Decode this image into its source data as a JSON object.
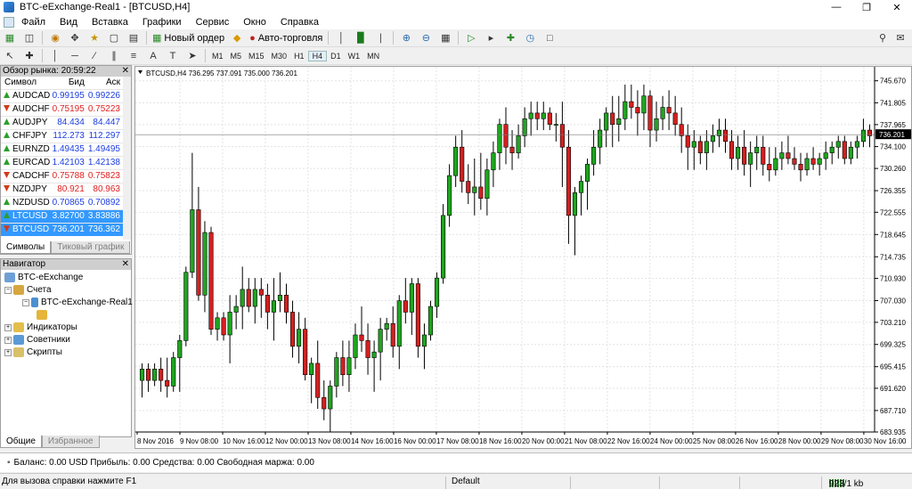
{
  "window": {
    "title": "BTC-eExchange-Real1 - [BTCUSD,H4]"
  },
  "menu": [
    "Файл",
    "Вид",
    "Вставка",
    "Графики",
    "Сервис",
    "Окно",
    "Справка"
  ],
  "toolbar": {
    "new_order": "Новый ордер",
    "autotrading": "Авто-торговля"
  },
  "timeframes": [
    "M1",
    "M5",
    "M15",
    "M30",
    "H1",
    "H4",
    "D1",
    "W1",
    "MN"
  ],
  "active_timeframe": "H4",
  "market_watch": {
    "header": "Обзор рынка: 20:59:22",
    "columns": [
      "Символ",
      "Бид",
      "Аск"
    ],
    "rows": [
      {
        "symbol": "AUDCAD",
        "bid": "0.99195",
        "ask": "0.99226",
        "dir": "up"
      },
      {
        "symbol": "AUDCHF",
        "bid": "0.75195",
        "ask": "0.75223",
        "dir": "down"
      },
      {
        "symbol": "AUDJPY",
        "bid": "84.434",
        "ask": "84.447",
        "dir": "up"
      },
      {
        "symbol": "CHFJPY",
        "bid": "112.273",
        "ask": "112.297",
        "dir": "up"
      },
      {
        "symbol": "EURNZD",
        "bid": "1.49435",
        "ask": "1.49495",
        "dir": "up"
      },
      {
        "symbol": "EURCAD",
        "bid": "1.42103",
        "ask": "1.42138",
        "dir": "up"
      },
      {
        "symbol": "CADCHF",
        "bid": "0.75788",
        "ask": "0.75823",
        "dir": "down"
      },
      {
        "symbol": "NZDJPY",
        "bid": "80.921",
        "ask": "80.963",
        "dir": "down"
      },
      {
        "symbol": "NZDUSD",
        "bid": "0.70865",
        "ask": "0.70892",
        "dir": "up"
      },
      {
        "symbol": "LTCUSD",
        "bid": "3.82700",
        "ask": "3.83886",
        "dir": "up",
        "selected": true
      },
      {
        "symbol": "BTCUSD",
        "bid": "736.201",
        "ask": "736.362",
        "dir": "down",
        "selected": true
      }
    ],
    "tabs": [
      "Символы",
      "Тиковый график"
    ]
  },
  "navigator": {
    "header": "Навигатор",
    "items": [
      "BTC-eExchange",
      "Счета",
      "BTC-eExchange-Real1",
      "Индикаторы",
      "Советники",
      "Скрипты"
    ],
    "tabs": [
      "Общие",
      "Избранное"
    ]
  },
  "chart_data": {
    "type": "candlestick",
    "title": "BTCUSD,H4  736.295 737.091 735.000 736.201",
    "current_price": "736.201",
    "price_axis": [
      "745.670",
      "741.805",
      "737.965",
      "734.100",
      "730.260",
      "726.355",
      "722.555",
      "718.645",
      "714.735",
      "710.930",
      "707.030",
      "703.210",
      "699.325",
      "695.415",
      "691.620",
      "687.710",
      "683.935"
    ],
    "time_axis": [
      "8 Nov 2016",
      "9 Nov 08:00",
      "10 Nov 16:00",
      "12 Nov 00:00",
      "13 Nov 08:00",
      "14 Nov 16:00",
      "16 Nov 00:00",
      "17 Nov 08:00",
      "18 Nov 16:00",
      "20 Nov 00:00",
      "21 Nov 08:00",
      "22 Nov 16:00",
      "24 Nov 00:00",
      "25 Nov 08:00",
      "26 Nov 16:00",
      "28 Nov 00:00",
      "29 Nov 08:00",
      "30 Nov 16:00"
    ],
    "ylim": [
      683.935,
      747.5
    ],
    "colors": {
      "bull": "#1fa51f",
      "bear": "#d42020",
      "grid": "#e3e3e3"
    },
    "candles": [
      [
        693,
        696,
        690,
        695
      ],
      [
        695,
        696,
        691,
        693
      ],
      [
        693,
        696,
        692,
        695
      ],
      [
        695,
        697,
        691,
        693
      ],
      [
        693,
        697,
        690,
        692
      ],
      [
        692,
        698,
        691,
        697
      ],
      [
        697,
        701,
        691,
        700
      ],
      [
        700,
        713,
        699,
        712
      ],
      [
        712,
        733,
        711,
        723
      ],
      [
        723,
        727,
        707,
        708
      ],
      [
        708,
        721,
        705,
        719
      ],
      [
        719,
        720,
        701,
        702
      ],
      [
        702,
        705,
        700,
        704
      ],
      [
        704,
        705,
        700,
        701
      ],
      [
        701,
        708,
        696,
        705
      ],
      [
        705,
        708,
        702,
        706
      ],
      [
        706,
        713,
        702,
        709
      ],
      [
        709,
        711,
        705,
        706
      ],
      [
        706,
        711,
        703,
        709
      ],
      [
        709,
        711,
        704,
        708
      ],
      [
        708,
        710,
        702,
        705
      ],
      [
        705,
        711,
        700,
        707
      ],
      [
        707,
        712,
        705,
        708
      ],
      [
        708,
        710,
        703,
        705
      ],
      [
        705,
        707,
        697,
        699
      ],
      [
        699,
        705,
        696,
        702
      ],
      [
        702,
        704,
        693,
        694
      ],
      [
        694,
        697,
        689,
        696
      ],
      [
        696,
        700,
        688,
        690
      ],
      [
        690,
        693,
        686,
        688
      ],
      [
        688,
        693,
        684,
        692
      ],
      [
        692,
        698,
        690,
        697
      ],
      [
        697,
        700,
        692,
        694
      ],
      [
        694,
        700,
        691,
        697
      ],
      [
        697,
        703,
        695,
        701
      ],
      [
        701,
        706,
        698,
        700
      ],
      [
        700,
        703,
        694,
        697
      ],
      [
        697,
        700,
        691,
        698
      ],
      [
        698,
        704,
        693,
        702
      ],
      [
        702,
        704,
        700,
        703
      ],
      [
        703,
        706,
        697,
        699
      ],
      [
        699,
        708,
        695,
        707
      ],
      [
        707,
        711,
        703,
        705
      ],
      [
        705,
        711,
        701,
        710
      ],
      [
        710,
        711,
        697,
        699
      ],
      [
        699,
        703,
        695,
        701
      ],
      [
        701,
        707,
        700,
        706
      ],
      [
        706,
        712,
        704,
        711
      ],
      [
        711,
        724,
        710,
        722
      ],
      [
        722,
        731,
        720,
        729
      ],
      [
        729,
        736,
        727,
        734
      ],
      [
        734,
        737,
        726,
        728
      ],
      [
        728,
        731,
        724,
        726
      ],
      [
        726,
        732,
        722,
        727
      ],
      [
        727,
        733,
        723,
        725
      ],
      [
        725,
        732,
        722,
        730
      ],
      [
        730,
        735,
        727,
        733
      ],
      [
        733,
        739,
        730,
        738
      ],
      [
        738,
        741,
        731,
        734
      ],
      [
        734,
        737,
        730,
        733
      ],
      [
        733,
        738,
        732,
        736
      ],
      [
        736,
        741,
        734,
        739
      ],
      [
        739,
        742,
        736,
        740
      ],
      [
        740,
        742,
        737,
        739
      ],
      [
        739,
        742,
        737,
        740
      ],
      [
        740,
        741,
        737,
        738
      ],
      [
        738,
        740,
        735,
        738
      ],
      [
        738,
        742,
        727,
        734
      ],
      [
        734,
        737,
        717,
        722
      ],
      [
        722,
        727,
        715,
        726
      ],
      [
        726,
        729,
        722,
        728
      ],
      [
        728,
        732,
        723,
        731
      ],
      [
        731,
        737,
        729,
        734
      ],
      [
        734,
        739,
        731,
        737
      ],
      [
        737,
        741,
        734,
        740
      ],
      [
        740,
        743,
        734,
        738
      ],
      [
        738,
        743,
        735,
        739
      ],
      [
        739,
        745,
        737,
        742
      ],
      [
        742,
        745,
        739,
        741
      ],
      [
        741,
        744,
        736,
        740
      ],
      [
        740,
        745,
        737,
        743
      ],
      [
        743,
        744,
        734,
        737
      ],
      [
        737,
        742,
        735,
        739
      ],
      [
        739,
        743,
        737,
        741
      ],
      [
        741,
        744,
        737,
        740
      ],
      [
        740,
        743,
        736,
        738
      ],
      [
        738,
        741,
        733,
        736
      ],
      [
        736,
        738,
        730,
        734
      ],
      [
        734,
        737,
        730,
        735
      ],
      [
        735,
        736,
        731,
        733
      ],
      [
        733,
        737,
        730,
        735
      ],
      [
        735,
        738,
        733,
        736
      ],
      [
        736,
        739,
        734,
        737
      ],
      [
        737,
        739,
        733,
        735
      ],
      [
        735,
        737,
        730,
        732
      ],
      [
        732,
        736,
        730,
        734
      ],
      [
        734,
        737,
        729,
        731
      ],
      [
        731,
        735,
        727,
        733
      ],
      [
        733,
        736,
        730,
        734
      ],
      [
        734,
        736,
        729,
        731
      ],
      [
        731,
        734,
        728,
        730
      ],
      [
        730,
        734,
        729,
        732
      ],
      [
        732,
        735,
        730,
        733
      ],
      [
        733,
        736,
        731,
        732
      ],
      [
        732,
        734,
        730,
        731
      ],
      [
        731,
        733,
        728,
        730
      ],
      [
        730,
        733,
        729,
        732
      ],
      [
        732,
        734,
        730,
        731
      ],
      [
        731,
        733,
        729,
        732
      ],
      [
        732,
        735,
        730,
        733
      ],
      [
        733,
        735,
        731,
        734
      ],
      [
        734,
        736,
        732,
        735
      ],
      [
        735,
        736,
        731,
        732
      ],
      [
        732,
        735,
        731,
        734
      ],
      [
        734,
        736,
        732,
        735
      ],
      [
        735,
        739,
        734,
        737
      ],
      [
        737,
        738,
        734,
        736
      ]
    ]
  },
  "statusbar": {
    "balance": "Баланс: 0.00 USD  Прибыль: 0.00  Средства: 0.00  Свободная маржа: 0.00",
    "help": "Для вызова справки нажмите F1",
    "profile": "Default",
    "traffic": "923/1 kb"
  }
}
